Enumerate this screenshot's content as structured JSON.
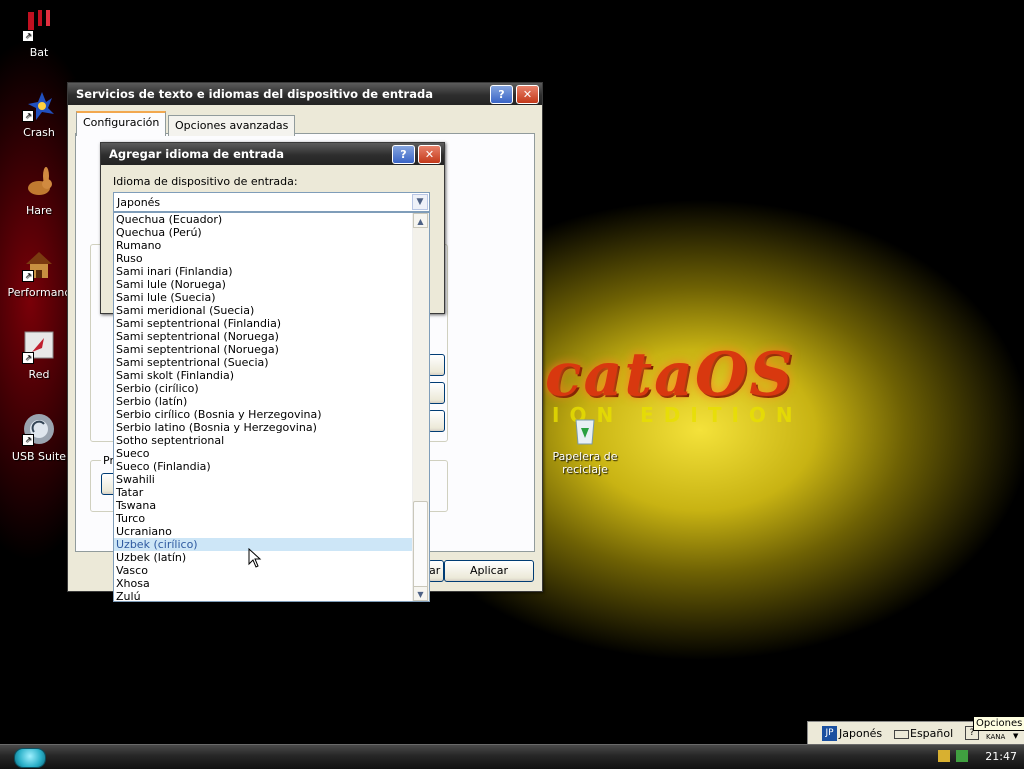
{
  "desktop_icons": [
    {
      "label": "Bat",
      "icon": "bat-icon"
    },
    {
      "label": "Crash",
      "icon": "crash-icon"
    },
    {
      "label": "Hare",
      "icon": "hare-icon"
    },
    {
      "label": "Performanc",
      "icon": "performance-icon"
    },
    {
      "label": "Red",
      "icon": "network-icon"
    },
    {
      "label": "USB Suite",
      "icon": "usb-icon"
    }
  ],
  "recycle_bin": {
    "label_line1": "Papelera de",
    "label_line2": "reciclaje"
  },
  "brand": {
    "logo_text": "cataOS",
    "sub_text": "ION EDITION"
  },
  "main_window": {
    "title": "Servicios de texto e idiomas del dispositivo de entrada",
    "tabs": [
      "Configuración",
      "Opciones avanzadas"
    ],
    "partial_group_label": "Pre",
    "partial_button": "ar",
    "apply_button": "Aplicar"
  },
  "dialog": {
    "title": "Agregar idioma de entrada",
    "field_label": "Idioma de dispositivo de entrada:",
    "selected_value": "Japonés"
  },
  "language_list": {
    "items": [
      "Quechua (Ecuador)",
      "Quechua (Perú)",
      "Rumano",
      "Ruso",
      "Sami inari (Finlandia)",
      "Sami lule (Noruega)",
      "Sami lule (Suecia)",
      "Sami meridional (Suecia)",
      "Sami septentrional (Finlandia)",
      "Sami septentrional (Noruega)",
      "Sami septentrional (Noruega)",
      "Sami septentrional (Suecia)",
      "Sami skolt (Finlandia)",
      "Serbio (cirílico)",
      "Serbio (latín)",
      "Serbio cirílico (Bosnia y Herzegovina)",
      "Serbio latino (Bosnia y Herzegovina)",
      "Sotho septentrional",
      "Sueco",
      "Sueco (Finlandia)",
      "Swahili",
      "Tatar",
      "Tswana",
      "Turco",
      "Ucraniano",
      "Uzbek (cirílico)",
      "Uzbek (latín)",
      "Vasco",
      "Xhosa",
      "Zulú"
    ],
    "highlighted": "Uzbek (cirílico)"
  },
  "language_bar": {
    "lang_code": "JP",
    "lang_name": "Japonés",
    "keyboard_name": "Español",
    "ime_label": "KANA",
    "tooltip": "Opciones"
  },
  "taskbar": {
    "clock": "21:47"
  },
  "colors": {
    "selection": "#cde6f7",
    "titlebar": "#2e2e2e",
    "window_bg": "#ece9d8"
  }
}
